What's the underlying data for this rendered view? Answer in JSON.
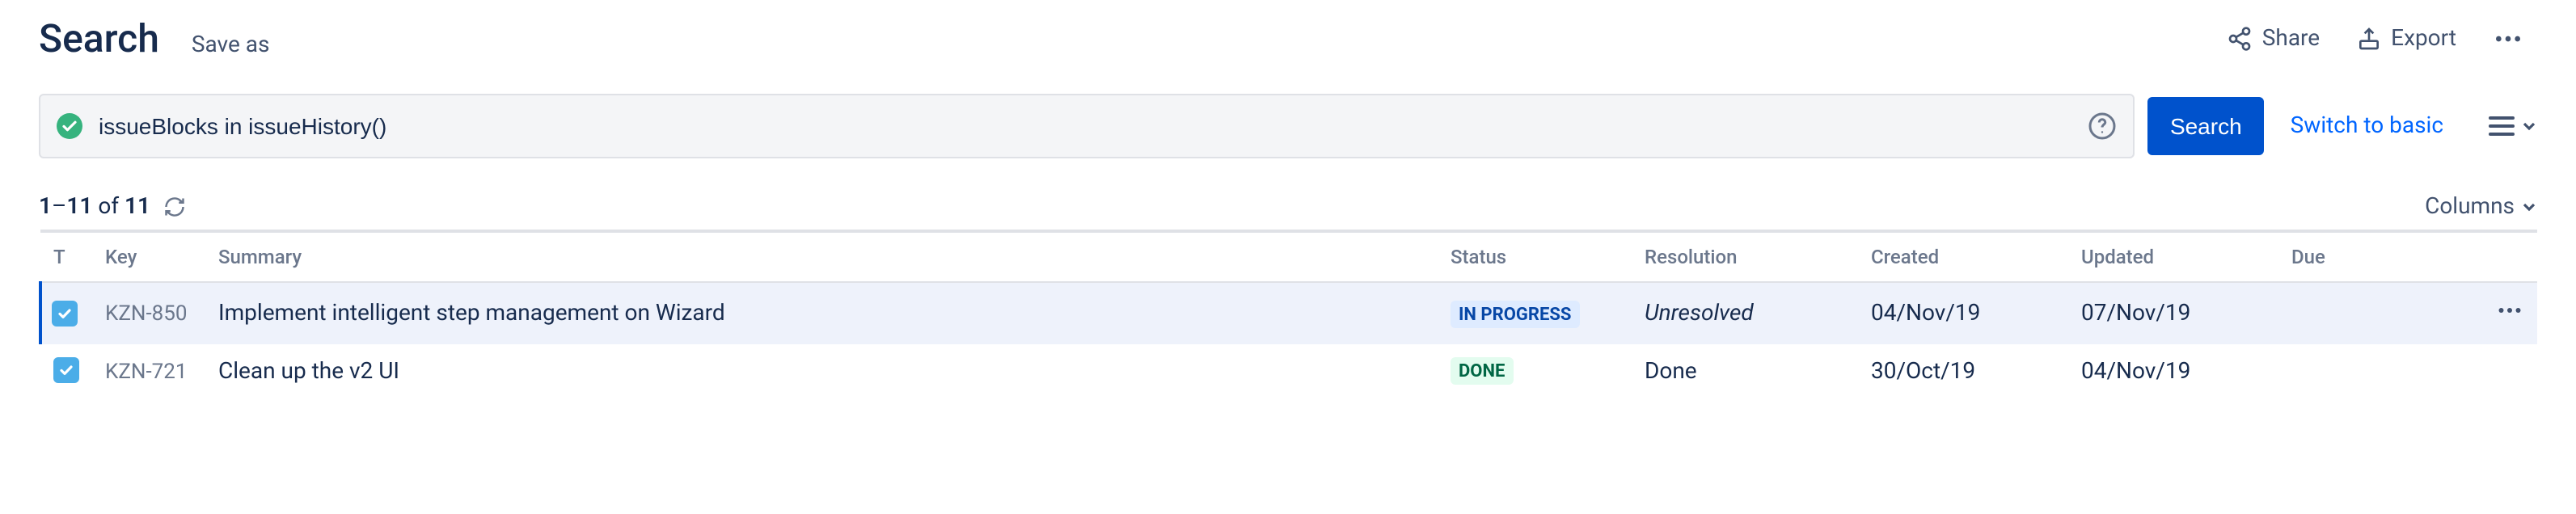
{
  "header": {
    "title": "Search",
    "save_as": "Save as",
    "share": "Share",
    "export": "Export"
  },
  "search": {
    "jql": "issueBlocks in issueHistory()",
    "button": "Search",
    "switch_basic": "Switch to basic"
  },
  "pagination": {
    "from": "1",
    "to": "11",
    "of_word": "of",
    "total": "11"
  },
  "columns_label": "Columns",
  "table": {
    "headers": {
      "t": "T",
      "key": "Key",
      "summary": "Summary",
      "status": "Status",
      "resolution": "Resolution",
      "created": "Created",
      "updated": "Updated",
      "due": "Due"
    },
    "rows": [
      {
        "key": "KZN-850",
        "summary": "Implement intelligent step management on Wizard",
        "status": "IN PROGRESS",
        "status_class": "lz-inprogress",
        "resolution": "Unresolved",
        "resolution_class": "unresolved",
        "created": "04/Nov/19",
        "updated": "07/Nov/19",
        "due": "",
        "selected": true
      },
      {
        "key": "KZN-721",
        "summary": "Clean up the v2 UI",
        "status": "DONE",
        "status_class": "lz-done",
        "resolution": "Done",
        "resolution_class": "",
        "created": "30/Oct/19",
        "updated": "04/Nov/19",
        "due": "",
        "selected": false
      }
    ]
  }
}
